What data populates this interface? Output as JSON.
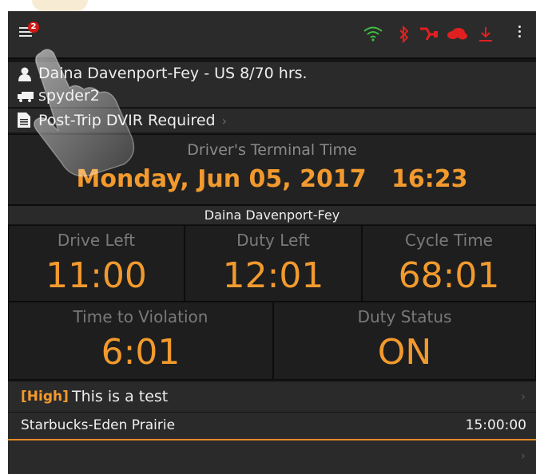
{
  "topbar": {
    "menu_badge": "2",
    "status_icons": [
      "wifi-icon",
      "bluetooth-icon",
      "eld-icon",
      "cloud-icon",
      "download-icon"
    ],
    "colors": {
      "wifi": "#3fbf3f",
      "alert": "#e02020"
    }
  },
  "driver_info": {
    "name_hours": "Daina Davenport-Fey - US 8/70 hrs.",
    "vehicle": "spyder2",
    "dvir": "Post-Trip DVIR Required",
    "dvir_chevron": "›"
  },
  "terminal": {
    "label": "Driver's Terminal Time",
    "date": "Monday, Jun 05, 2017",
    "time": "16:23"
  },
  "hos": {
    "driver_name": "Daina Davenport-Fey",
    "drive_left_label": "Drive Left",
    "drive_left": "11:00",
    "duty_left_label": "Duty Left",
    "duty_left": "12:01",
    "cycle_time_label": "Cycle Time",
    "cycle_time": "68:01",
    "violation_label": "Time to Violation",
    "violation": "6:01",
    "duty_status_label": "Duty Status",
    "duty_status": "ON"
  },
  "message": {
    "priority": "[High]",
    "text": "This is a test",
    "chevron": "›"
  },
  "location": {
    "name": "Starbucks-Eden Prairie",
    "time": "15:00:00",
    "chevron": "›"
  },
  "accent_color": "#f29a2e"
}
